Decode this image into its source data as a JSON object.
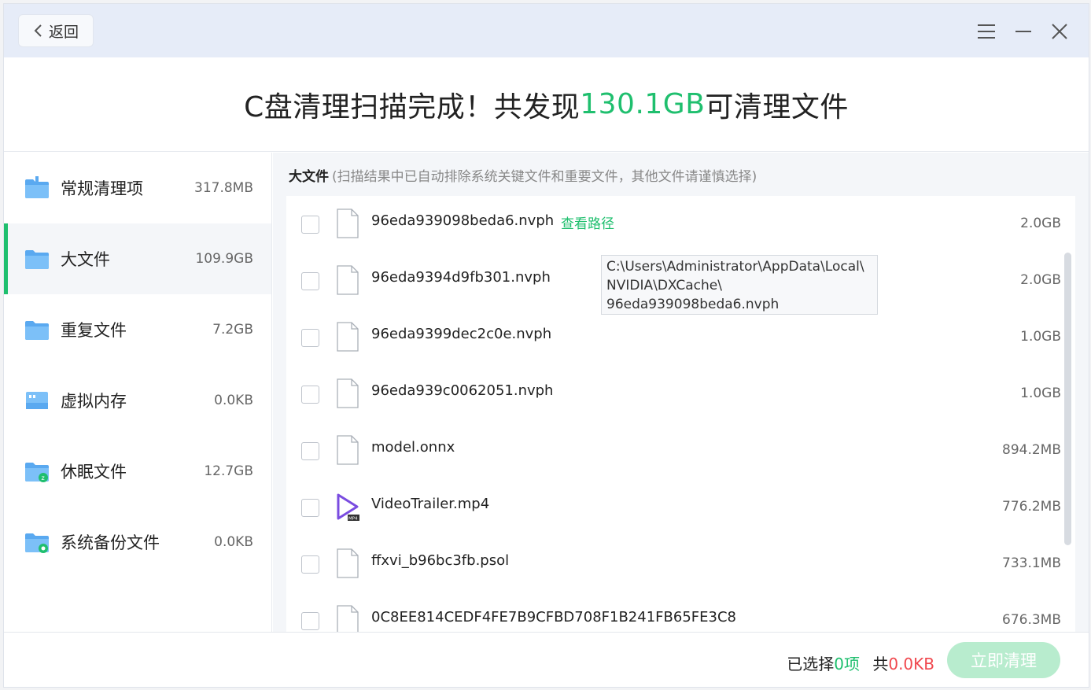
{
  "titlebar": {
    "back_label": "返回"
  },
  "header": {
    "prefix": "C盘清理扫描完成！共发现",
    "amount": "130.1GB",
    "suffix": "可清理文件"
  },
  "sidebar": {
    "items": [
      {
        "label": "常规清理项",
        "size": "317.8MB",
        "icon": "folder-icon"
      },
      {
        "label": "大文件",
        "size": "109.9GB",
        "icon": "folder-icon"
      },
      {
        "label": "重复文件",
        "size": "7.2GB",
        "icon": "folder-icon"
      },
      {
        "label": "虚拟内存",
        "size": "0.0KB",
        "icon": "memory-icon"
      },
      {
        "label": "休眠文件",
        "size": "12.7GB",
        "icon": "sleep-folder-icon"
      },
      {
        "label": "系统备份文件",
        "size": "0.0KB",
        "icon": "backup-folder-icon"
      }
    ]
  },
  "main": {
    "title": "大文件",
    "subtitle": "(扫描结果中已自动排除系统关键文件和重要文件，其他文件请谨慎选择)",
    "view_path_label": "查看路径",
    "tooltip_lines": [
      "C:\\Users\\Administrator\\AppData\\Local\\",
      "NVIDIA\\DXCache\\",
      "96eda939098beda6.nvph"
    ],
    "files": [
      {
        "name": "96eda939098beda6.nvph",
        "size": "2.0GB",
        "icon": "file-icon"
      },
      {
        "name": "96eda9394d9fb301.nvph",
        "size": "2.0GB",
        "icon": "file-icon"
      },
      {
        "name": "96eda9399dec2c0e.nvph",
        "size": "1.0GB",
        "icon": "file-icon"
      },
      {
        "name": "96eda939c0062051.nvph",
        "size": "1.0GB",
        "icon": "file-icon"
      },
      {
        "name": "model.onnx",
        "size": "894.2MB",
        "icon": "file-icon"
      },
      {
        "name": "VideoTrailer.mp4",
        "size": "776.2MB",
        "icon": "video-file-icon"
      },
      {
        "name": "ffxvi_b96bc3fb.psol",
        "size": "733.1MB",
        "icon": "file-icon"
      },
      {
        "name": "0C8EE814CEDF4FE7B9CFBD708F1B241FB65FE3C8",
        "size": "676.3MB",
        "icon": "file-icon"
      }
    ]
  },
  "footer": {
    "selected_prefix": "已选择",
    "selected_count": "0项",
    "total_prefix": "共",
    "total_size": "0.0KB",
    "clean_label": "立即清理"
  },
  "colors": {
    "accent": "#1fbf6e",
    "danger": "#f0484e",
    "titlebar_bg": "#e6ecf8",
    "button_disabled": "#b8ecce"
  }
}
